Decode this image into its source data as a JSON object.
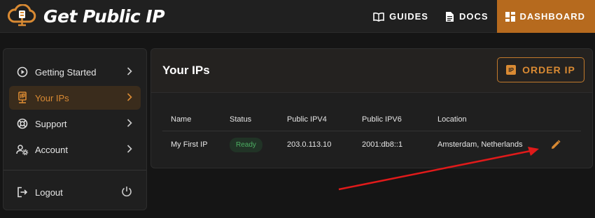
{
  "brand": {
    "name": "Get Public IP"
  },
  "nav": [
    {
      "label": "GUIDES",
      "icon": "book-icon"
    },
    {
      "label": "DOCS",
      "icon": "document-icon"
    },
    {
      "label": "DASHBOARD",
      "icon": "dashboard-icon",
      "active": true
    }
  ],
  "sidebar": {
    "items": [
      {
        "label": "Getting Started",
        "icon": "play-circle-icon"
      },
      {
        "label": "Your IPs",
        "icon": "ip-icon",
        "active": true
      },
      {
        "label": "Support",
        "icon": "support-icon"
      },
      {
        "label": "Account",
        "icon": "account-settings-icon"
      }
    ],
    "logout": {
      "label": "Logout",
      "icon": "logout-icon"
    }
  },
  "main": {
    "title": "Your IPs",
    "order_button": {
      "label": "ORDER IP",
      "badge": "IP"
    },
    "table": {
      "columns": [
        "Name",
        "Status",
        "Public IPV4",
        "Public IPV6",
        "Location"
      ],
      "rows": [
        {
          "name": "My First IP",
          "status": "Ready",
          "ipv4": "203.0.113.10",
          "ipv6": "2001:db8::1",
          "location": "Amsterdam, Netherlands"
        }
      ]
    }
  },
  "colors": {
    "accent": "#d98a33",
    "active_nav": "#b66a1e",
    "status_ready": "#4caf62",
    "annotation": "#e01a1a"
  }
}
